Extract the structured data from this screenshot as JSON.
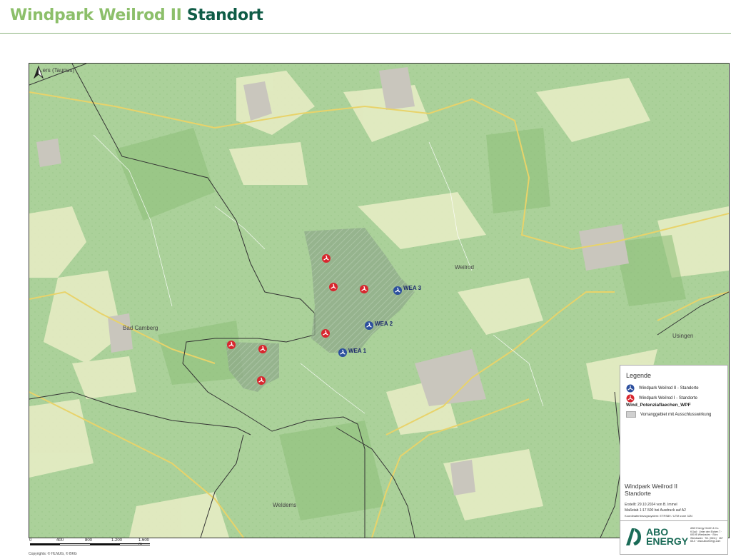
{
  "header": {
    "title_part1": "Windpark Weilrod II",
    "title_part2": "Standort"
  },
  "map": {
    "places": {
      "niederems": "...ers (Taunus)",
      "weilrod": "Weilrod",
      "bad_camberg": "Bad Camberg",
      "usingen": "Usingen",
      "wiesbaden_label": "Weldems"
    },
    "turbines_new": [
      "WEA 1",
      "WEA 2",
      "WEA 3"
    ]
  },
  "scale": {
    "labels": [
      "0",
      "400",
      "800",
      "1.200",
      "1.600 m"
    ]
  },
  "copyright": "Copyrights: © HLNUG, © BKG",
  "legend": {
    "title": "Legende",
    "item_new": "Windpark Weilrod II - Standorte",
    "item_old": "Windpark Weilrod I - Standorte",
    "group_heading": "Wind_Potenziaflaechen_WPF",
    "item_area": "Vorranggebiet mit Ausschlusswirkung"
  },
  "info": {
    "title_line1": "Windpark Weilrod II",
    "title_line2": "Standorte",
    "created": "Erstellt: 29.10.2024 von B. Immel",
    "scale": "Maßstab 1:17.500  bei Ausdruck auf A2",
    "crs": "Koordinatenbezugssystem: ETRS89 / UTM zone 32N"
  },
  "logo": {
    "line1": "ABO",
    "line2": "ENERGY",
    "address": "ABO Energy GmbH & Co. KGaA · Unter den Eichen 7 · 65195 Wiesbaden · Büro Wiesbaden · Tel. (0611) · 267 65-0 · www.aboenergy.com"
  },
  "colors": {
    "turbine_new": "#2c4f9e",
    "turbine_old": "#d8262e",
    "forest": "#a9cf92",
    "accent": "#0f5c46"
  }
}
